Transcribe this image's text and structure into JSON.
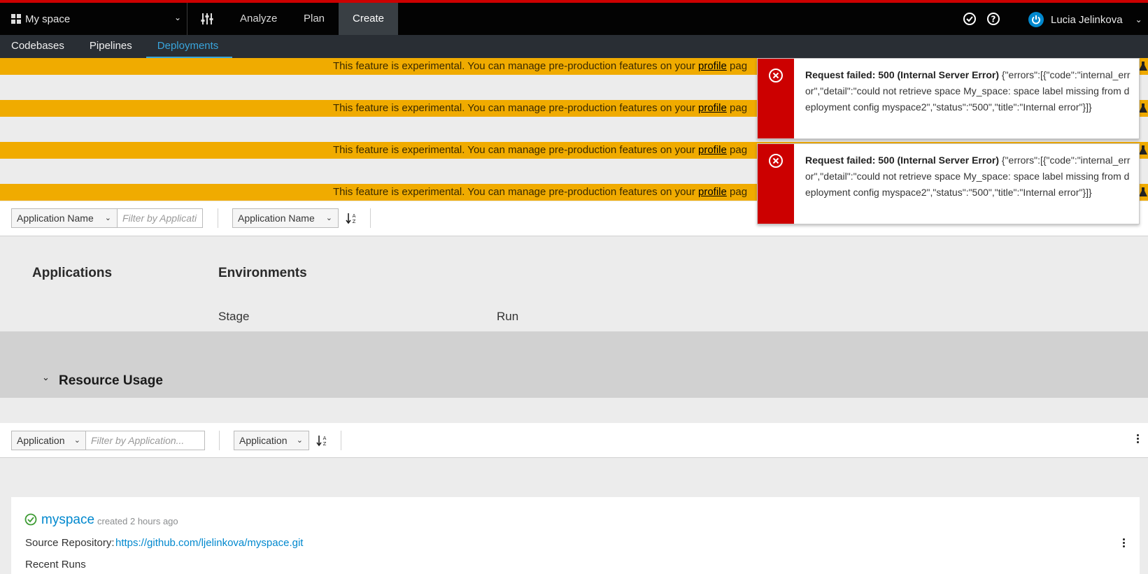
{
  "topbar": {
    "space_name": "My space",
    "nav": [
      "Analyze",
      "Plan",
      "Create"
    ],
    "active_nav": "Create",
    "user_name": "Lucia Jelinkova",
    "accent_color": "#cc0000"
  },
  "subnav": {
    "items": [
      "Codebases",
      "Pipelines",
      "Deployments"
    ],
    "active": "Deployments"
  },
  "banners": [
    {
      "text": "This feature is experimental. You can manage pre-production features on your ",
      "link": "profile",
      "tail": " pag"
    },
    {
      "text": "This feature is experimental. You can manage pre-production features on your ",
      "link": "profile",
      "tail": " pag"
    },
    {
      "text": "This feature is experimental. You can manage pre-production features on your ",
      "link": "profile",
      "tail": " pag"
    },
    {
      "text": "This feature is experimental. You can manage pre-production features on your ",
      "link": "profile",
      "tail": " pag"
    }
  ],
  "toolbar1": {
    "filter_field": "Application Name",
    "filter_placeholder": "Filter by Applicati",
    "sort_field": "Application Name"
  },
  "headers": {
    "applications": "Applications",
    "environments": "Environments",
    "stage": "Stage",
    "run": "Run"
  },
  "resource_usage": {
    "title": "Resource Usage"
  },
  "toolbar2": {
    "filter_field": "Application",
    "filter_placeholder": "Filter by Application...",
    "sort_field": "Application"
  },
  "application_card": {
    "name": "myspace",
    "created": "created 2 hours ago",
    "repo_label": "Source Repository:",
    "repo_url": "https://github.com/ljelinkova/myspace.git",
    "recent_runs": "Recent Runs"
  },
  "toasts": [
    {
      "title": "Request failed: 500 (Internal Server Error)",
      "body": " {\"errors\":[{\"code\":\"internal_error\",\"detail\":\"could not retrieve space My_space: space label missing from deployment config myspace2\",\"status\":\"500\",\"title\":\"Internal error\"}]}"
    },
    {
      "title": "Request failed: 500 (Internal Server Error)",
      "body": " {\"errors\":[{\"code\":\"internal_error\",\"detail\":\"could not retrieve space My_space: space label missing from deployment config myspace2\",\"status\":\"500\",\"title\":\"Internal error\"}]}"
    }
  ]
}
